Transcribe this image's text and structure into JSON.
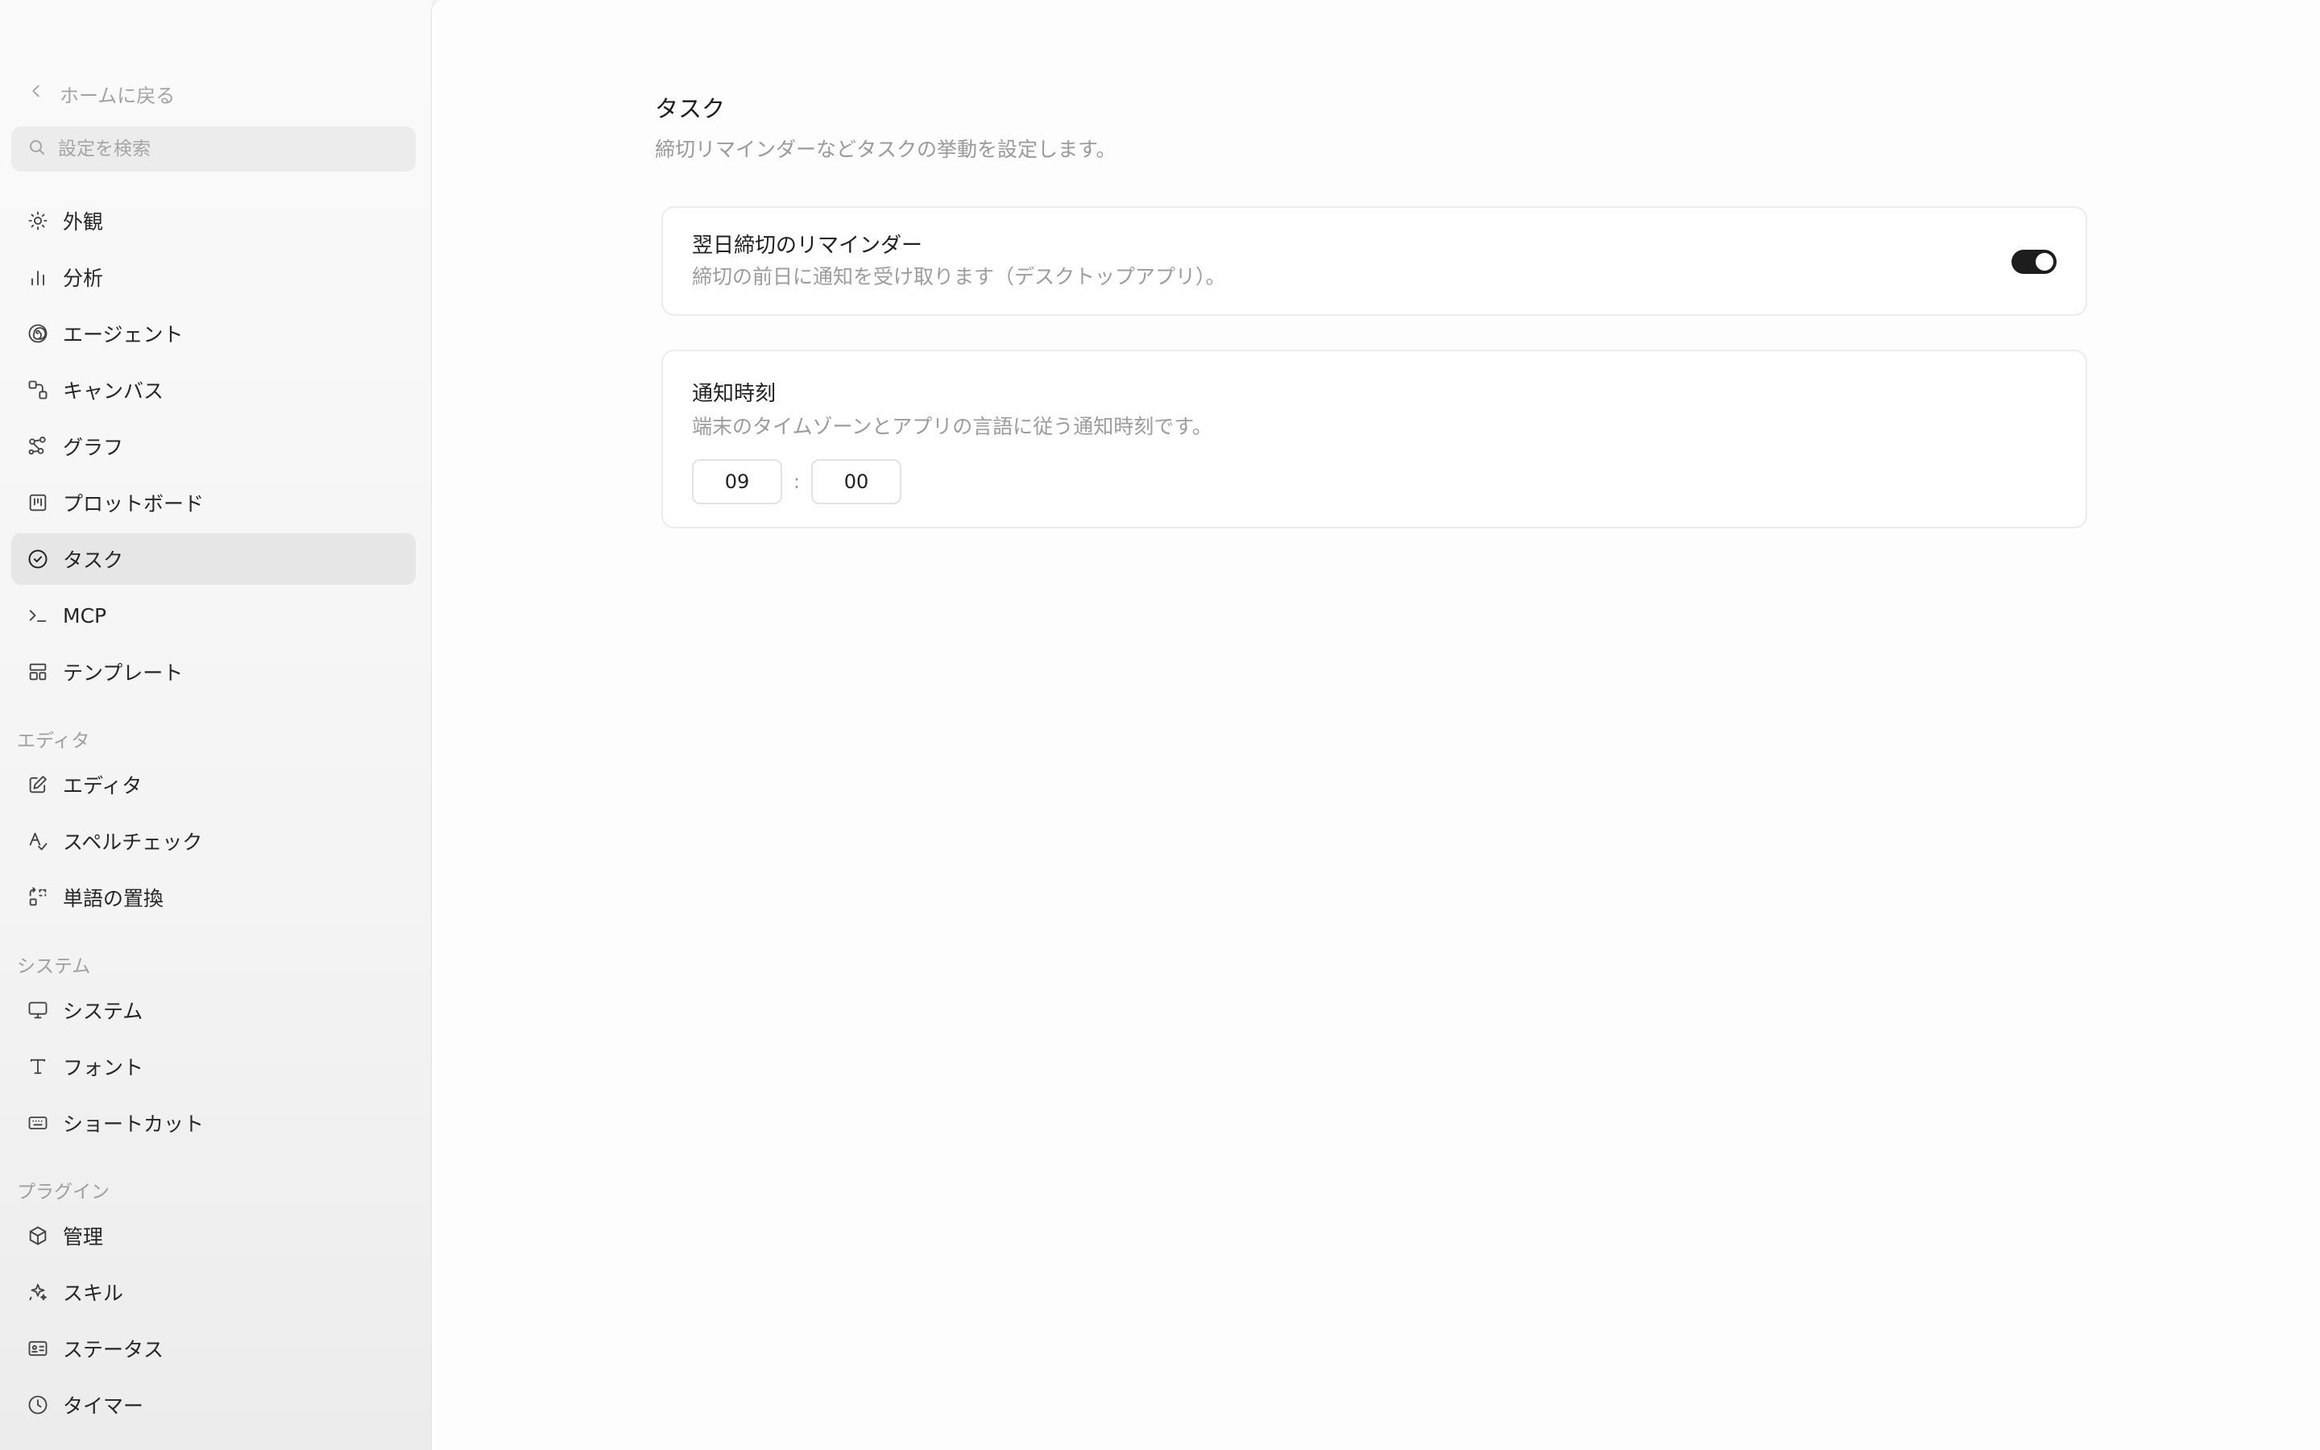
{
  "sidebar": {
    "back_label": "ホームに戻る",
    "search_placeholder": "設定を検索",
    "items": [
      {
        "label": "外観"
      },
      {
        "label": "分析"
      },
      {
        "label": "エージェント"
      },
      {
        "label": "キャンバス"
      },
      {
        "label": "グラフ"
      },
      {
        "label": "プロットボード"
      },
      {
        "label": "タスク"
      },
      {
        "label": "MCP"
      },
      {
        "label": "テンプレート"
      }
    ],
    "sections": [
      {
        "label": "エディタ",
        "items": [
          {
            "label": "エディタ"
          },
          {
            "label": "スペルチェック"
          },
          {
            "label": "単語の置換"
          }
        ]
      },
      {
        "label": "システム",
        "items": [
          {
            "label": "システム"
          },
          {
            "label": "フォント"
          },
          {
            "label": "ショートカット"
          }
        ]
      },
      {
        "label": "プラグイン",
        "items": [
          {
            "label": "管理"
          },
          {
            "label": "スキル"
          },
          {
            "label": "ステータス"
          },
          {
            "label": "タイマー"
          }
        ]
      }
    ],
    "active_item": "タスク"
  },
  "main": {
    "title": "タスク",
    "description": "締切リマインダーなどタスクの挙動を設定します。",
    "reminder_card": {
      "title": "翌日締切のリマインダー",
      "description": "締切の前日に通知を受け取ります（デスクトップアプリ）。",
      "enabled": true
    },
    "time_card": {
      "title": "通知時刻",
      "description": "端末のタイムゾーンとアプリの言語に従う通知時刻です。",
      "hour": "09",
      "separator": ":",
      "minute": "00"
    }
  },
  "colors": {
    "toggle_on": "#1d1d1d",
    "active_bg": "#e6e6e6",
    "muted_text": "#9c9c9c"
  }
}
